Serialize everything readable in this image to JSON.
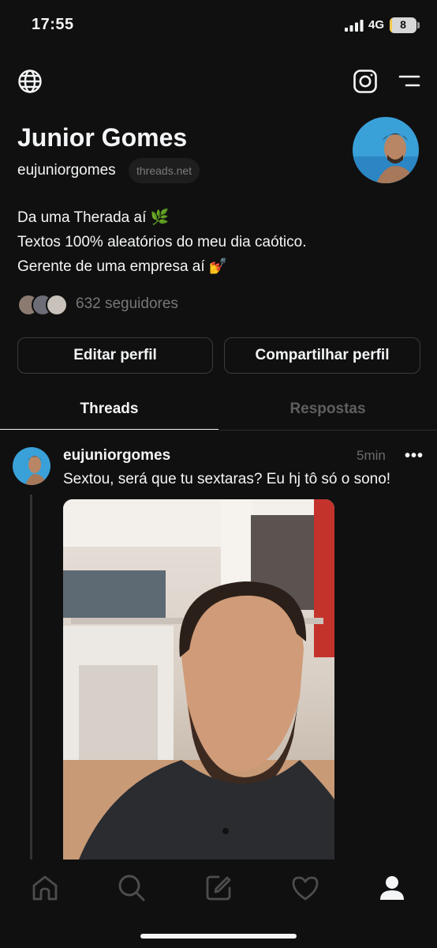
{
  "status_bar": {
    "time": "17:55",
    "network": "4G",
    "battery": "8",
    "battery_level": 0.08
  },
  "top_nav": {
    "left_icon": "globe-icon",
    "right_icons": [
      "instagram-icon",
      "menu-icon"
    ]
  },
  "profile": {
    "name": "Junior Gomes",
    "handle": "eujuniorgomes",
    "domain_badge": "threads.net",
    "bio": [
      "Da uma Therada aí 🌿",
      "Textos 100% aleatórios do meu dia caótico.",
      "Gerente de uma empresa aí 💅"
    ],
    "followers": "632 seguidores"
  },
  "actions": {
    "edit": "Editar perfil",
    "share": "Compartilhar perfil"
  },
  "tabs": [
    {
      "label": "Threads",
      "active": true
    },
    {
      "label": "Respostas",
      "active": false
    }
  ],
  "post": {
    "username": "eujuniorgomes",
    "time": "5min",
    "more": "•••",
    "text": "Sextou, será que tu sextaras? Eu hj tô só o sono!"
  },
  "bottom_nav": [
    "home-icon",
    "search-icon",
    "compose-icon",
    "heart-icon",
    "profile-icon"
  ]
}
